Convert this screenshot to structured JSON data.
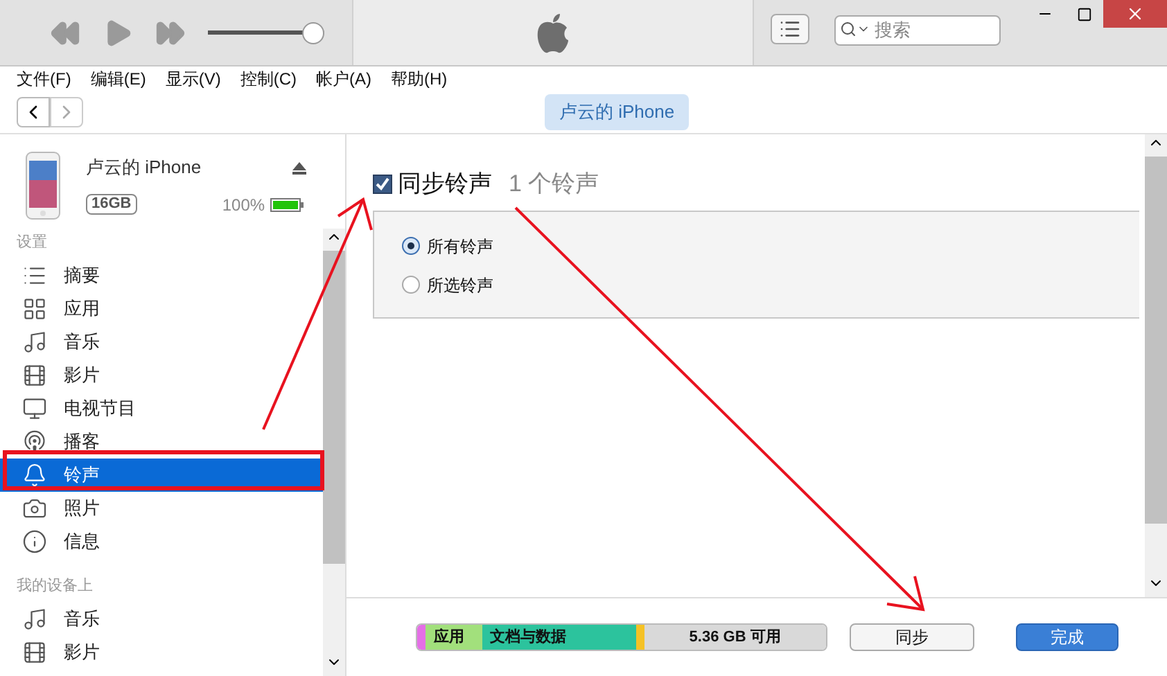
{
  "toolbar": {
    "volume": {
      "level": 0.9
    },
    "search": {
      "placeholder": "搜索"
    }
  },
  "menu": [
    "文件(F)",
    "编辑(E)",
    "显示(V)",
    "控制(C)",
    "帐户(A)",
    "帮助(H)"
  ],
  "device_tab": "卢云的 iPhone",
  "device": {
    "name": "卢云的 iPhone",
    "capacity": "16GB",
    "battery": "100%",
    "battery_level": {
      "level": 1
    }
  },
  "sidebar": [
    {
      "heading": "设置",
      "items": [
        {
          "label": "摘要",
          "kind": "summary",
          "selected": false
        },
        {
          "label": "应用",
          "kind": "apps",
          "selected": false
        },
        {
          "label": "音乐",
          "kind": "music",
          "selected": false
        },
        {
          "label": "影片",
          "kind": "movies",
          "selected": false
        },
        {
          "label": "电视节目",
          "kind": "tv",
          "selected": false
        },
        {
          "label": "播客",
          "kind": "podcast",
          "selected": false
        },
        {
          "label": "铃声",
          "kind": "tones",
          "selected": true
        },
        {
          "label": "照片",
          "kind": "photos",
          "selected": false
        },
        {
          "label": "信息",
          "kind": "info",
          "selected": false
        }
      ]
    },
    {
      "heading": "我的设备上",
      "items": [
        {
          "label": "音乐",
          "kind": "music",
          "selected": false
        },
        {
          "label": "影片",
          "kind": "movies",
          "selected": false
        }
      ]
    }
  ],
  "sync": {
    "label": "同步铃声",
    "checked": true,
    "count": "1 个铃声",
    "options": [
      {
        "label": "所有铃声",
        "selected": true
      },
      {
        "label": "所选铃声",
        "selected": false
      }
    ]
  },
  "storage": [
    {
      "color": "#e46fe6",
      "level": 0.014
    },
    {
      "label": "应用",
      "color": "#a2e07c",
      "level": 0.139
    },
    {
      "label": "文档与数据",
      "color": "#2cc39d",
      "level": 0.38
    },
    {
      "color": "#f5c226",
      "level": 0.017
    },
    {
      "label": "5.36 GB 可用",
      "color": "#d9d9d9",
      "level": 0.45
    }
  ],
  "buttons": [
    {
      "label": "同步",
      "kind": "secondary"
    },
    {
      "label": "完成",
      "kind": "primary"
    }
  ]
}
